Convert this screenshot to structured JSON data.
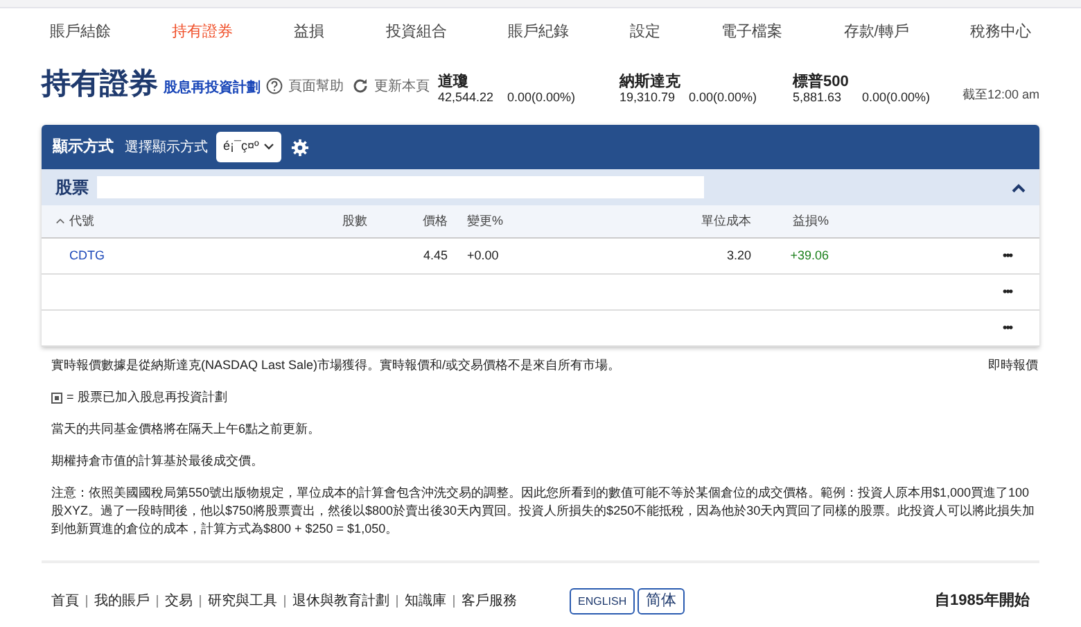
{
  "nav": [
    {
      "label": "賬戶結餘",
      "selected": false
    },
    {
      "label": "持有證券",
      "selected": true
    },
    {
      "label": "益損",
      "selected": false
    },
    {
      "label": "投資組合",
      "selected": false
    },
    {
      "label": "賬戶紀錄",
      "selected": false
    },
    {
      "label": "設定",
      "selected": false
    },
    {
      "label": "電子檔案",
      "selected": false
    },
    {
      "label": "存款/轉戶",
      "selected": false
    },
    {
      "label": "稅務中心",
      "selected": false
    }
  ],
  "header": {
    "title": "持有證券",
    "drip_link": "股息再投資計劃",
    "help": "頁面幫助",
    "refresh": "更新本頁"
  },
  "indices": [
    {
      "name": "道瓊",
      "value": "42,544.22",
      "change": "0.00(0.00%)"
    },
    {
      "name": "納斯達克",
      "value": "19,310.79",
      "change": "0.00(0.00%)"
    },
    {
      "name": "標普500",
      "value": "5,881.63",
      "change": "0.00(0.00%)"
    }
  ],
  "as_of": "截至12:00 am",
  "panel": {
    "title": "顯示方式",
    "select_label": "選擇顯示方式",
    "select_value": "é¡¯ç¤º",
    "section": "股票",
    "expanded": true
  },
  "table": {
    "columns": [
      "代號",
      "股數",
      "價格",
      "變更%",
      "單位成本",
      "益損%"
    ],
    "rows": [
      {
        "cells": [
          "CDTG",
          "",
          "4.45",
          "+0.00",
          "3.20",
          "+39.06"
        ],
        "more": "•••"
      },
      {
        "cells": [
          "",
          "",
          "",
          "",
          "",
          ""
        ],
        "more": "•••"
      },
      {
        "cells": [
          "",
          "",
          "",
          "",
          "",
          ""
        ],
        "more": "•••"
      }
    ]
  },
  "notes": {
    "realtime": "實時報價數據是從納斯達克(NASDAQ Last Sale)市場獲得。實時報價和/或交易價格不是來自所有市場。",
    "realtime_link": "即時報價",
    "drip_note": "= 股票已加入股息再投資計劃",
    "fund_note": "當天的共同基金價格將在隔天上午6點之前更新。",
    "value_note": "期權持倉市值的計算基於最後成交價。",
    "irs_note": "注意：依照美國國稅局第550號出版物規定，單位成本的計算會包含沖洗交易的調整。因此您所看到的數值可能不等於某個倉位的成交價格。範例：投資人原本用$1,000買進了100股XYZ。過了一段時間後，他以$750將股票賣出，然後以$800於賣出後30天內買回。投資人所損失的$250不能抵稅，因為他於30天內買回了同樣的股票。此投資人可以將此損失加到他新買進的倉位的成本，計算方式為$800 + $250 = $1,050。"
  },
  "footer": {
    "links": [
      "首頁",
      "我的賬戶",
      "交易",
      "研究與工具",
      "退休與教育計劃",
      "知識庫",
      "客戶服務"
    ],
    "languages": [
      "ENGLISH",
      "简体"
    ],
    "since": "自1985年開始"
  }
}
